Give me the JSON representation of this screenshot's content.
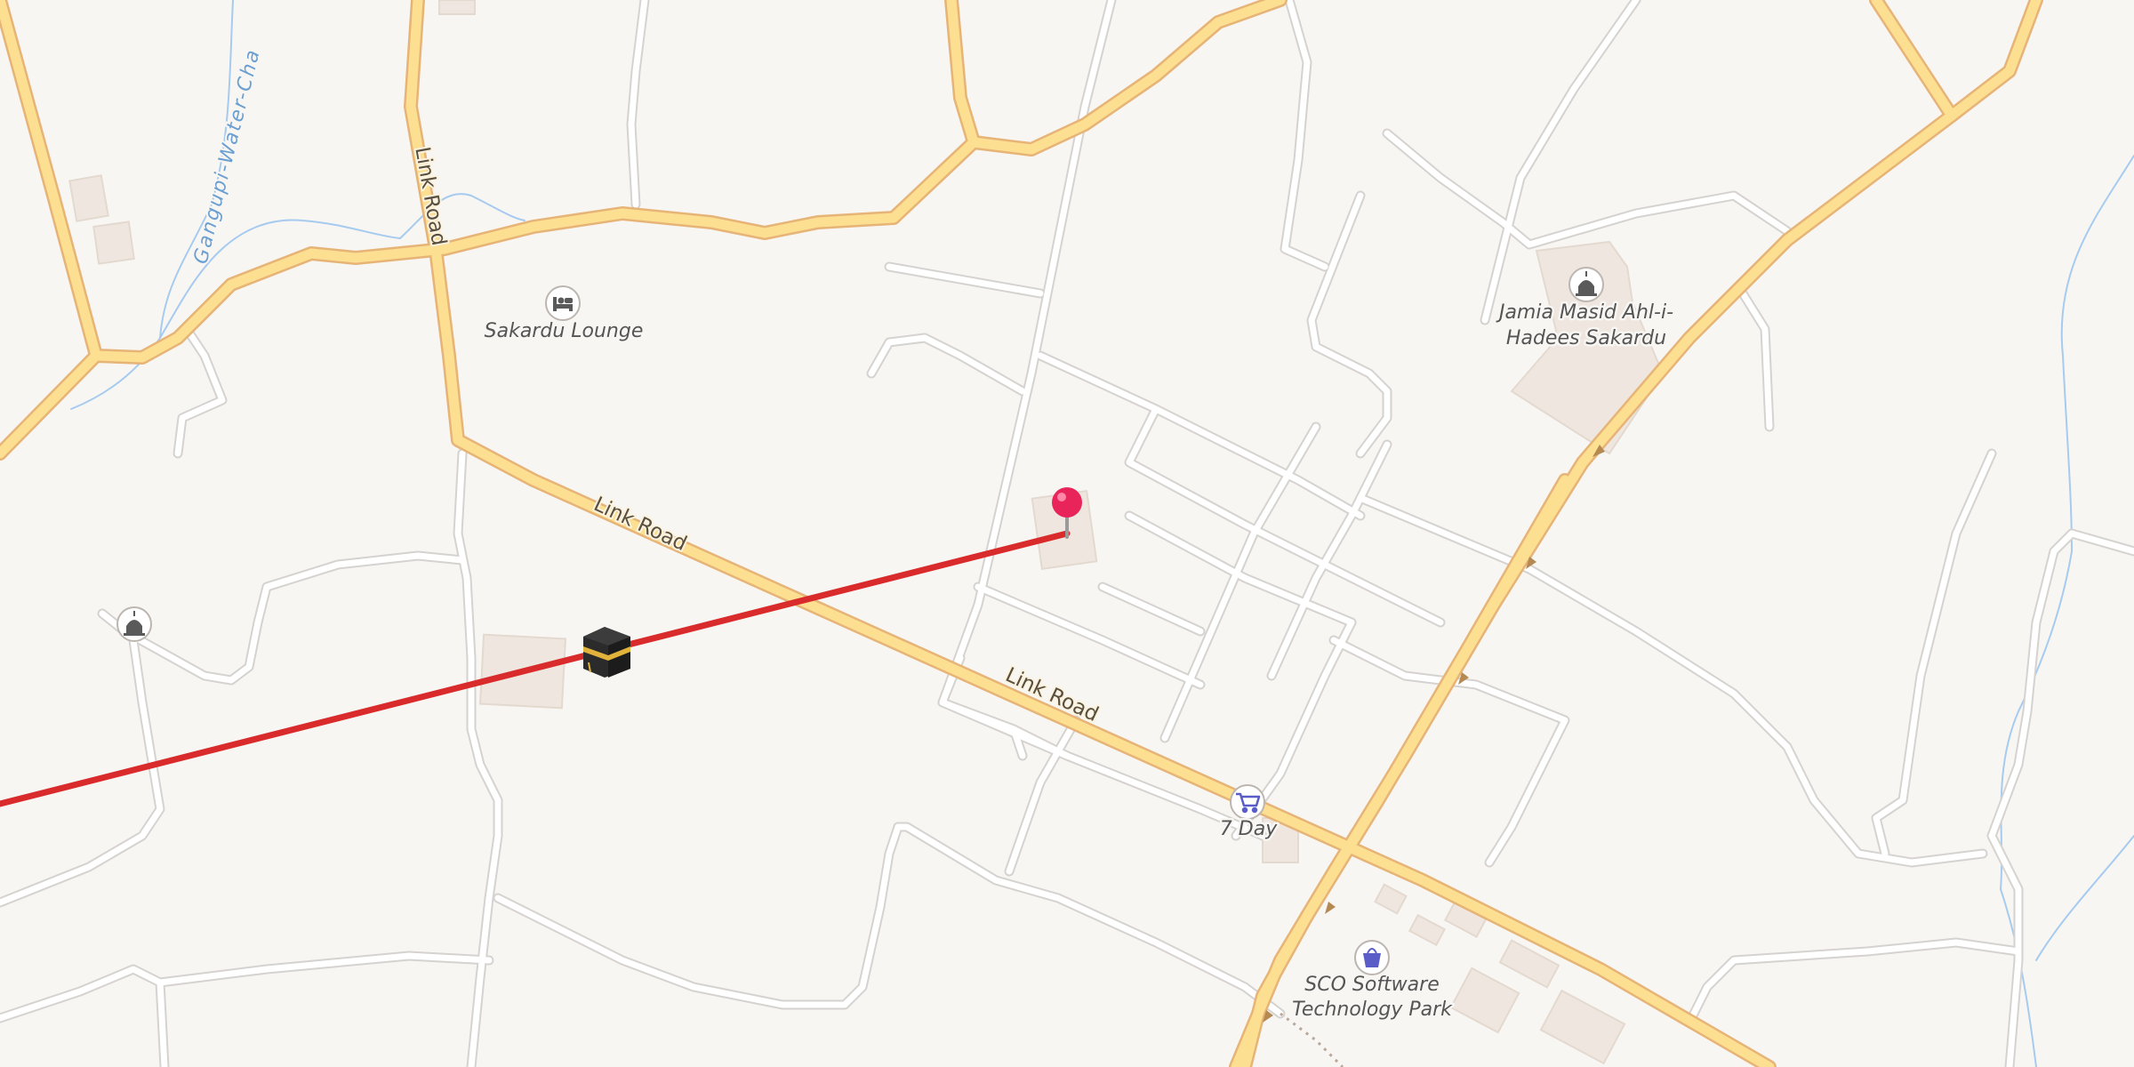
{
  "map": {
    "road_labels": {
      "link_road_vertical": "Link Road",
      "link_road_upper": "Link Road",
      "link_road_lower": "Link Road"
    },
    "water_label": "Gangupi-Water-Cha",
    "pois": {
      "lodging": {
        "label": "Sakardu Lounge",
        "icon": "bed-icon"
      },
      "mosque_main": {
        "label_line1": "Jamia Masid Ahl-i-",
        "label_line2": "Hadees Sakardu",
        "icon": "mosque-icon"
      },
      "mosque_small": {
        "icon": "mosque-icon"
      },
      "shop": {
        "label": "7 Day",
        "icon": "shopping-cart-icon"
      },
      "business_park": {
        "label_line1": "SCO Software",
        "label_line2": "Technology Park",
        "icon": "shopping-bag-icon"
      }
    },
    "markers": {
      "location_pin": {
        "icon": "map-pin-icon",
        "color": "#e8245a"
      },
      "kaaba": {
        "icon": "kaaba-icon"
      }
    },
    "bearing_line": {
      "description": "qibla-direction-line",
      "color": "#d92b2b"
    },
    "colors": {
      "background": "#f8f6f3",
      "major_road_fill": "#fcdf91",
      "major_road_casing": "#e7b478",
      "minor_road": "#ffffff",
      "water": "#a6cbef",
      "poi_icon_blue": "#5a5cc8"
    }
  }
}
